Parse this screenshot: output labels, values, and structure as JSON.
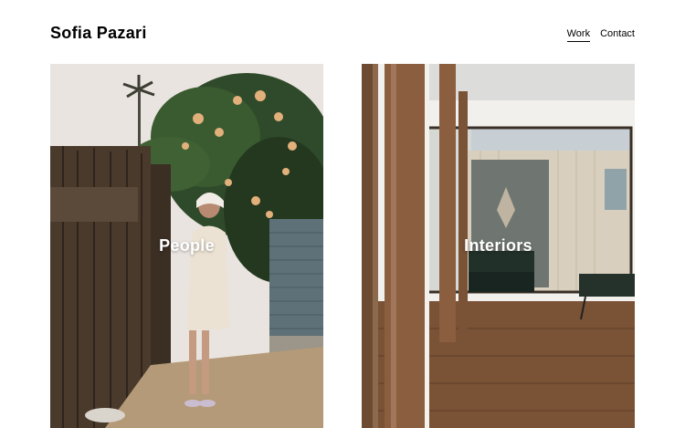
{
  "site": {
    "title": "Sofia Pazari"
  },
  "nav": {
    "work": "Work",
    "contact": "Contact",
    "active": "Work"
  },
  "tiles": [
    {
      "label": "People"
    },
    {
      "label": "Interiors"
    }
  ]
}
